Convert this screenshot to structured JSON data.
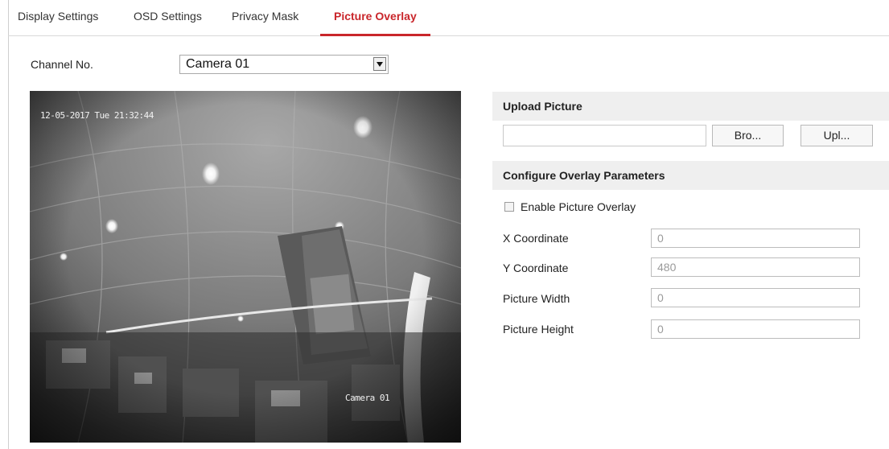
{
  "tabs": [
    {
      "label": "Display Settings"
    },
    {
      "label": "OSD Settings"
    },
    {
      "label": "Privacy Mask"
    },
    {
      "label": "Picture Overlay",
      "active": true
    }
  ],
  "channel": {
    "label": "Channel No.",
    "value": "Camera 01"
  },
  "video": {
    "timestamp": "12-05-2017 Tue 21:32:44",
    "camera_name": "Camera 01"
  },
  "upload": {
    "title": "Upload Picture",
    "file_value": "",
    "browse_label": "Bro...",
    "upload_label": "Upl..."
  },
  "overlay": {
    "title": "Configure Overlay Parameters",
    "enable_label": "Enable Picture Overlay",
    "enabled": false,
    "fields": [
      {
        "label": "X Coordinate",
        "value": "0"
      },
      {
        "label": "Y Coordinate",
        "value": "480"
      },
      {
        "label": "Picture Width",
        "value": "0"
      },
      {
        "label": "Picture Height",
        "value": "0"
      }
    ]
  },
  "colors": {
    "accent": "#c9262b",
    "section_bg": "#efefef"
  }
}
